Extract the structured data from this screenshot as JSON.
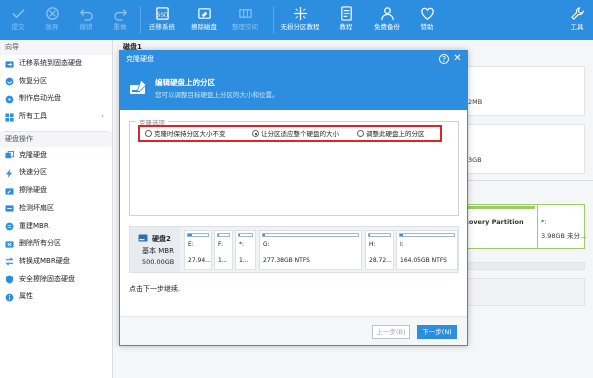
{
  "toolbar": {
    "buttons": [
      {
        "label": "提交",
        "icon": "check-icon",
        "enabled": false
      },
      {
        "label": "放弃",
        "icon": "discard-icon",
        "enabled": false
      },
      {
        "label": "撤销",
        "icon": "undo-icon",
        "enabled": false
      },
      {
        "label": "重做",
        "icon": "redo-icon",
        "enabled": false
      },
      {
        "label": "迁移系统",
        "icon": "migrate-os-icon",
        "enabled": true
      },
      {
        "label": "擦除磁盘",
        "icon": "wipe-disk-icon",
        "enabled": true
      },
      {
        "label": "整理空间",
        "icon": "allocate-space-icon",
        "enabled": false
      },
      {
        "label": "无损分区教程",
        "icon": "partition-tutorial-icon",
        "enabled": true
      },
      {
        "label": "教程",
        "icon": "tutorial-icon",
        "enabled": true
      },
      {
        "label": "免费备份",
        "icon": "free-backup-icon",
        "enabled": true
      },
      {
        "label": "赞助",
        "icon": "heart-icon",
        "enabled": true
      },
      {
        "label": "工具",
        "icon": "tools-icon",
        "enabled": true
      }
    ]
  },
  "sidebar": {
    "section1": "向导",
    "wizard": [
      "迁移系统到固态硬盘",
      "恢复分区",
      "制作启动光盘",
      "所有工具"
    ],
    "section2": "硬盘操作",
    "disk_ops": [
      "克隆硬盘",
      "快速分区",
      "擦除硬盘",
      "检测坏扇区",
      "重建MBR",
      "删除所有分区",
      "转换成MBR硬盘",
      "安全擦除固态硬盘",
      "属性"
    ]
  },
  "background": {
    "disk_title": "磁盘1",
    "size_a": "2MB",
    "size_b": "3GB",
    "partition_name": "covery Partition",
    "partition_star": "*:",
    "partition_size": "3.98GB 未分..."
  },
  "dialog": {
    "title": "克隆硬盘",
    "heading": "编辑硬盘上的分区",
    "subheading": "您可以调整目标硬盘上分区的大小和位置。",
    "options_legend": "克隆选项",
    "options": [
      {
        "label": "克隆时保持分区大小不变",
        "selected": false
      },
      {
        "label": "让分区适应整个硬盘的大小",
        "selected": true
      },
      {
        "label": "调整此硬盘上的分区",
        "selected": false
      }
    ],
    "disk": {
      "name": "硬盘2",
      "type": "基本 MBR",
      "size": "500.00GB",
      "partitions": [
        {
          "label": "E:",
          "size": "27.94...",
          "fill": 0.18
        },
        {
          "label": "F:",
          "size": "1...",
          "fill": 0.05
        },
        {
          "label": "*:",
          "size": "1...",
          "fill": 0.05
        },
        {
          "label": "G:",
          "size": "277.38GB NTFS",
          "fill": 0.02
        },
        {
          "label": "H:",
          "size": "28.72...",
          "fill": 0.05
        },
        {
          "label": "I:",
          "size": "164.05GB NTFS",
          "fill": 0.06
        }
      ]
    },
    "hint": "点击下一步继续.",
    "prev_label": "上一步(B)",
    "next_label": "下一步(N)"
  },
  "colors": {
    "accent": "#2d8ee0",
    "highlight": "#d9262a",
    "partition_fill": "#3a8ee6"
  }
}
